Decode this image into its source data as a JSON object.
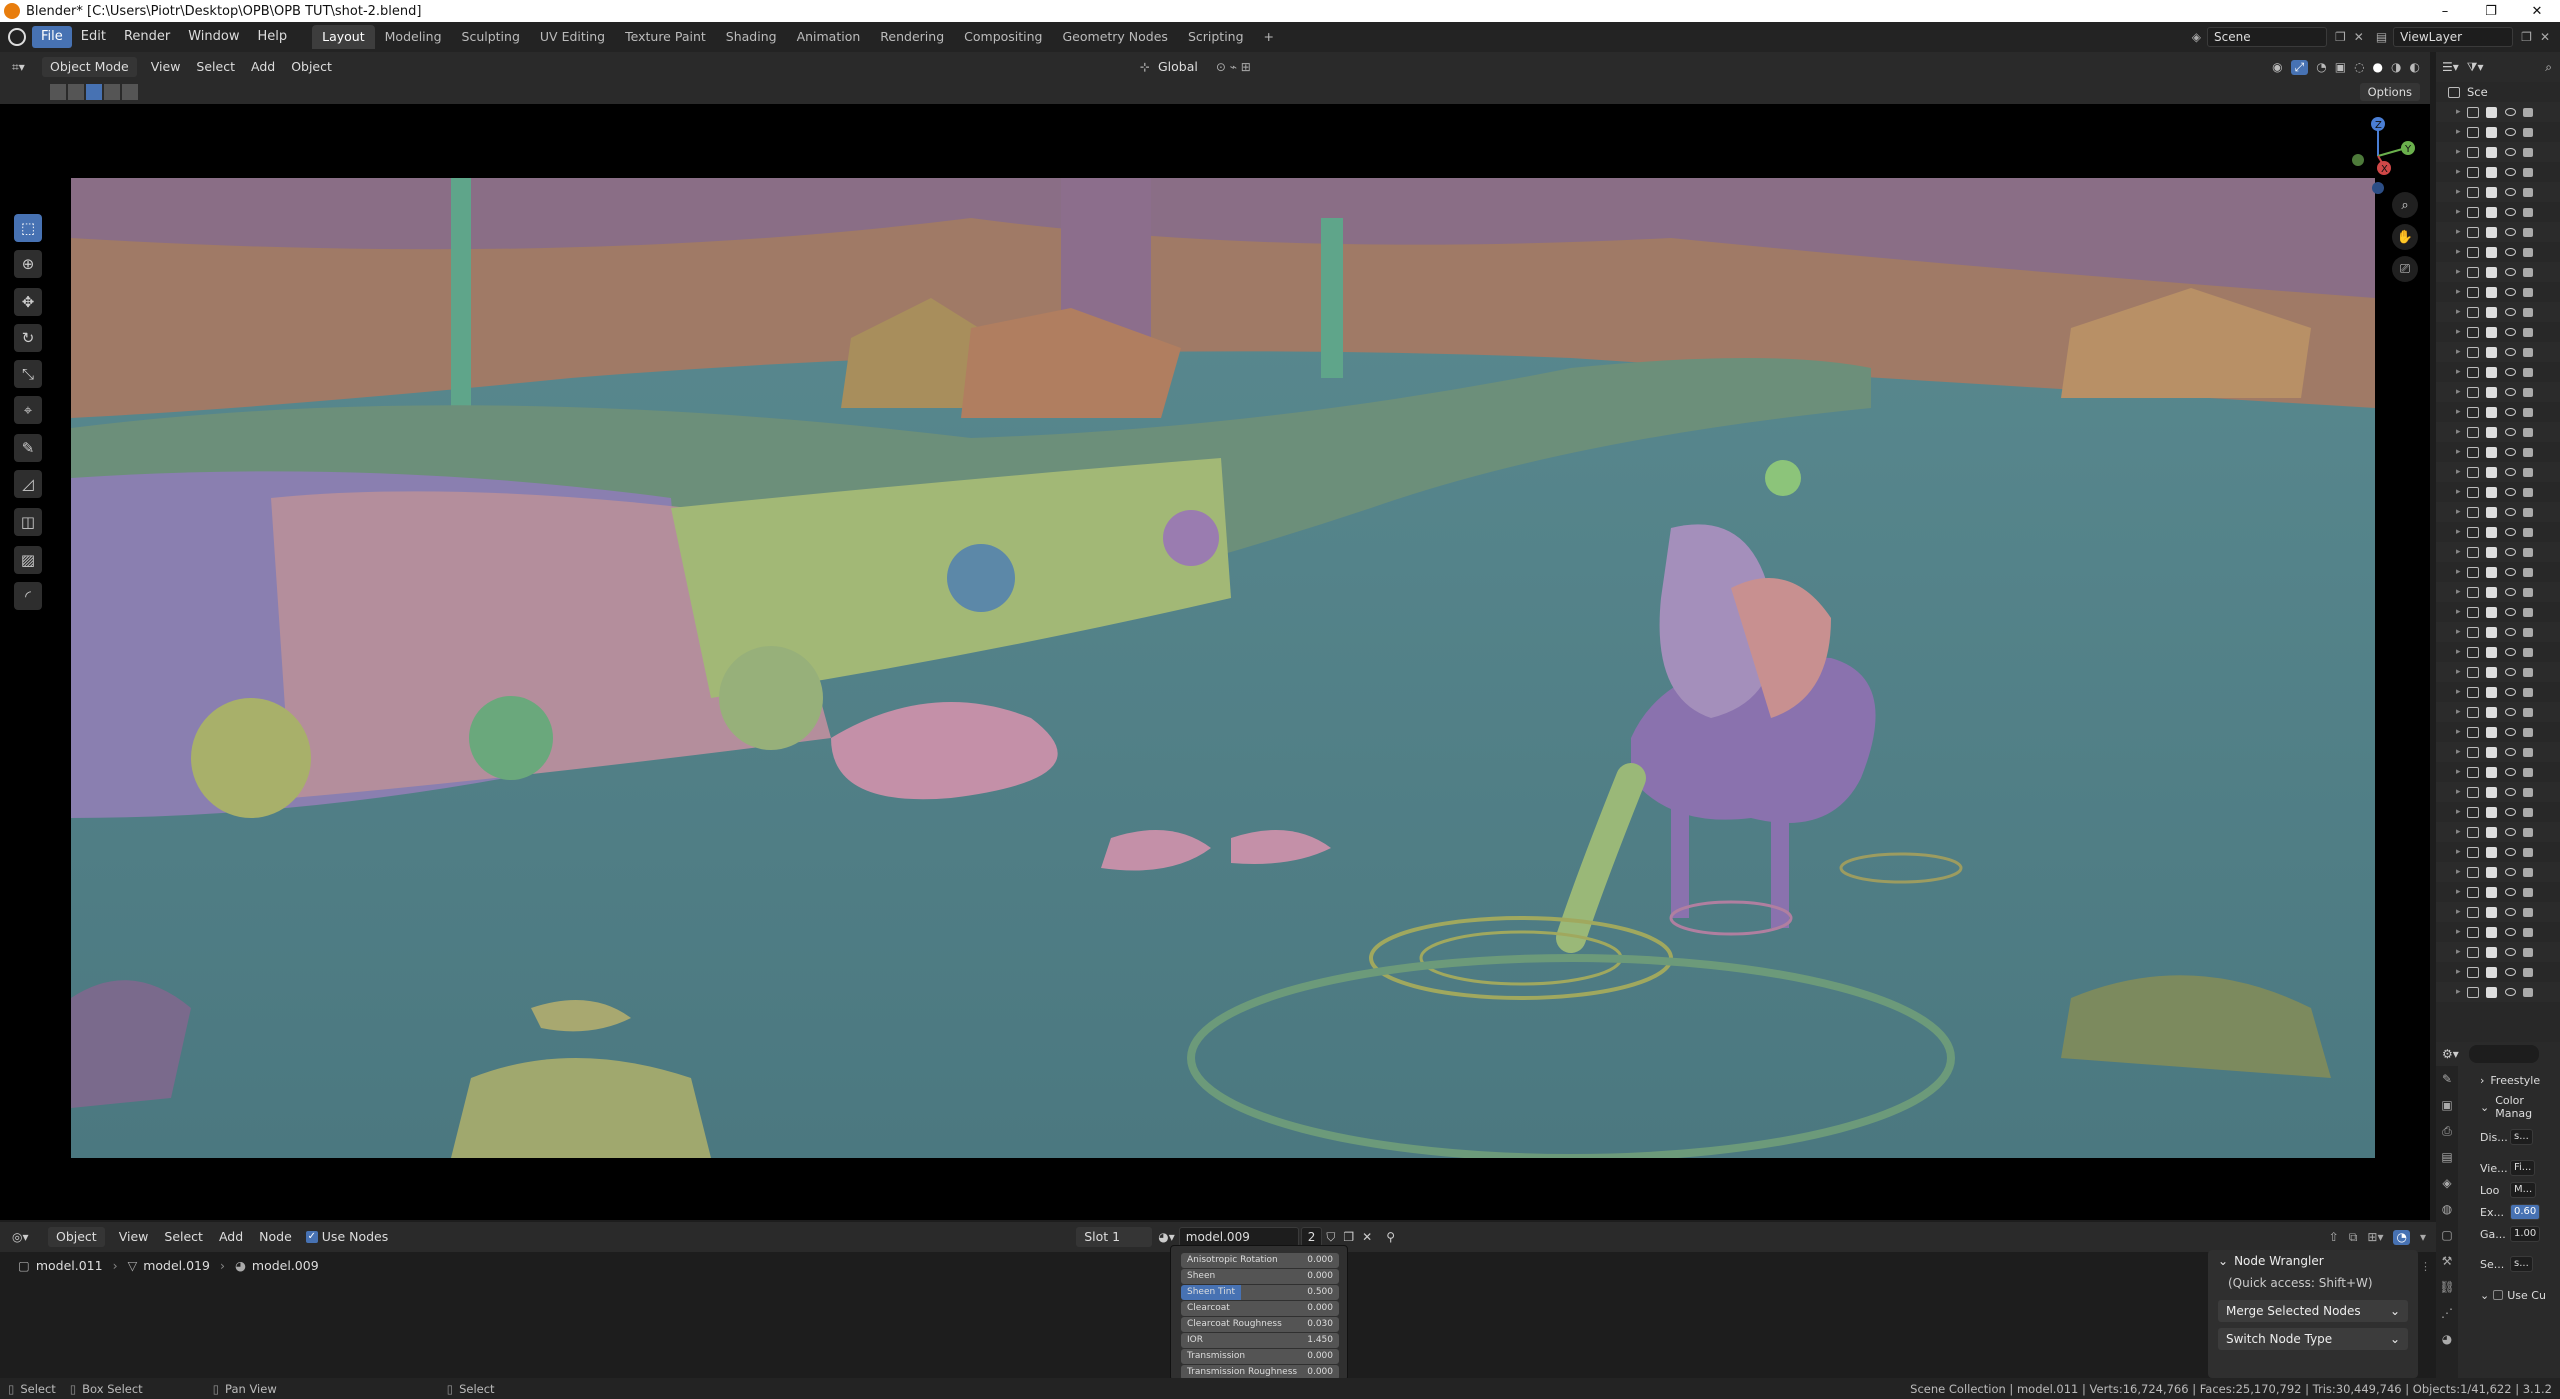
{
  "window": {
    "title": "Blender* [C:\\Users\\Piotr\\Desktop\\OPB\\OPB TUT\\shot-2.blend]",
    "controls": [
      "–",
      "❐",
      "✕"
    ]
  },
  "menu": {
    "items": [
      "File",
      "Edit",
      "Render",
      "Window",
      "Help"
    ],
    "workspaces": [
      "Layout",
      "Modeling",
      "Sculpting",
      "UV Editing",
      "Texture Paint",
      "Shading",
      "Animation",
      "Rendering",
      "Compositing",
      "Geometry Nodes",
      "Scripting"
    ],
    "add_tab": "+",
    "scene": "Scene",
    "view_layer": "ViewLayer"
  },
  "viewport_header": {
    "mode": "Object Mode",
    "menus": [
      "View",
      "Select",
      "Add",
      "Object"
    ],
    "transform": "Global",
    "options": "Options"
  },
  "gizmo": {
    "x": "X",
    "y": "Y",
    "z": "Z"
  },
  "outliner": {
    "header": "Sce",
    "row_count": 45
  },
  "properties": {
    "rows": [
      {
        "label": "Freestyle",
        "value": ""
      },
      {
        "label": "Color Manag",
        "value": ""
      },
      {
        "label": "Dis...",
        "value": "s..."
      },
      {
        "label": "Vie...",
        "value": "Fi..."
      },
      {
        "label": "Loo",
        "value": "M..."
      },
      {
        "label": "Ex...",
        "value": "0.60"
      },
      {
        "label": "Ga...",
        "value": "1.00"
      },
      {
        "label": "Se...",
        "value": "s..."
      },
      {
        "label": "Use Cu",
        "value": ""
      }
    ]
  },
  "node_editor": {
    "mode": "Object",
    "menus": [
      "View",
      "Select",
      "Add",
      "Node"
    ],
    "use_nodes": "Use Nodes",
    "slot": "Slot 1",
    "material": "model.009",
    "users": "2",
    "breadcrumb": [
      "model.011",
      "model.019",
      "model.009"
    ],
    "bsdf_rows": [
      {
        "label": "Anisotropic Rotation",
        "value": "0.000"
      },
      {
        "label": "Sheen",
        "value": "0.000"
      },
      {
        "label": "Sheen Tint",
        "value": "0.500"
      },
      {
        "label": "Clearcoat",
        "value": "0.000"
      },
      {
        "label": "Clearcoat Roughness",
        "value": "0.030"
      },
      {
        "label": "IOR",
        "value": "1.450"
      },
      {
        "label": "Transmission",
        "value": "0.000"
      },
      {
        "label": "Transmission Roughness",
        "value": "0.000"
      }
    ],
    "node_wrangler": {
      "title": "Node Wrangler",
      "hint": "(Quick access: Shift+W)",
      "button1": "Merge Selected Nodes",
      "button2": "Switch Node Type"
    }
  },
  "status": {
    "left": [
      "Select",
      "Box Select",
      "Pan View",
      "Select"
    ],
    "right": "Scene Collection | model.011 | Verts:16,724,766 | Faces:25,170,792 | Tris:30,449,746 | Objects:1/41,622 | 3.1.2"
  }
}
